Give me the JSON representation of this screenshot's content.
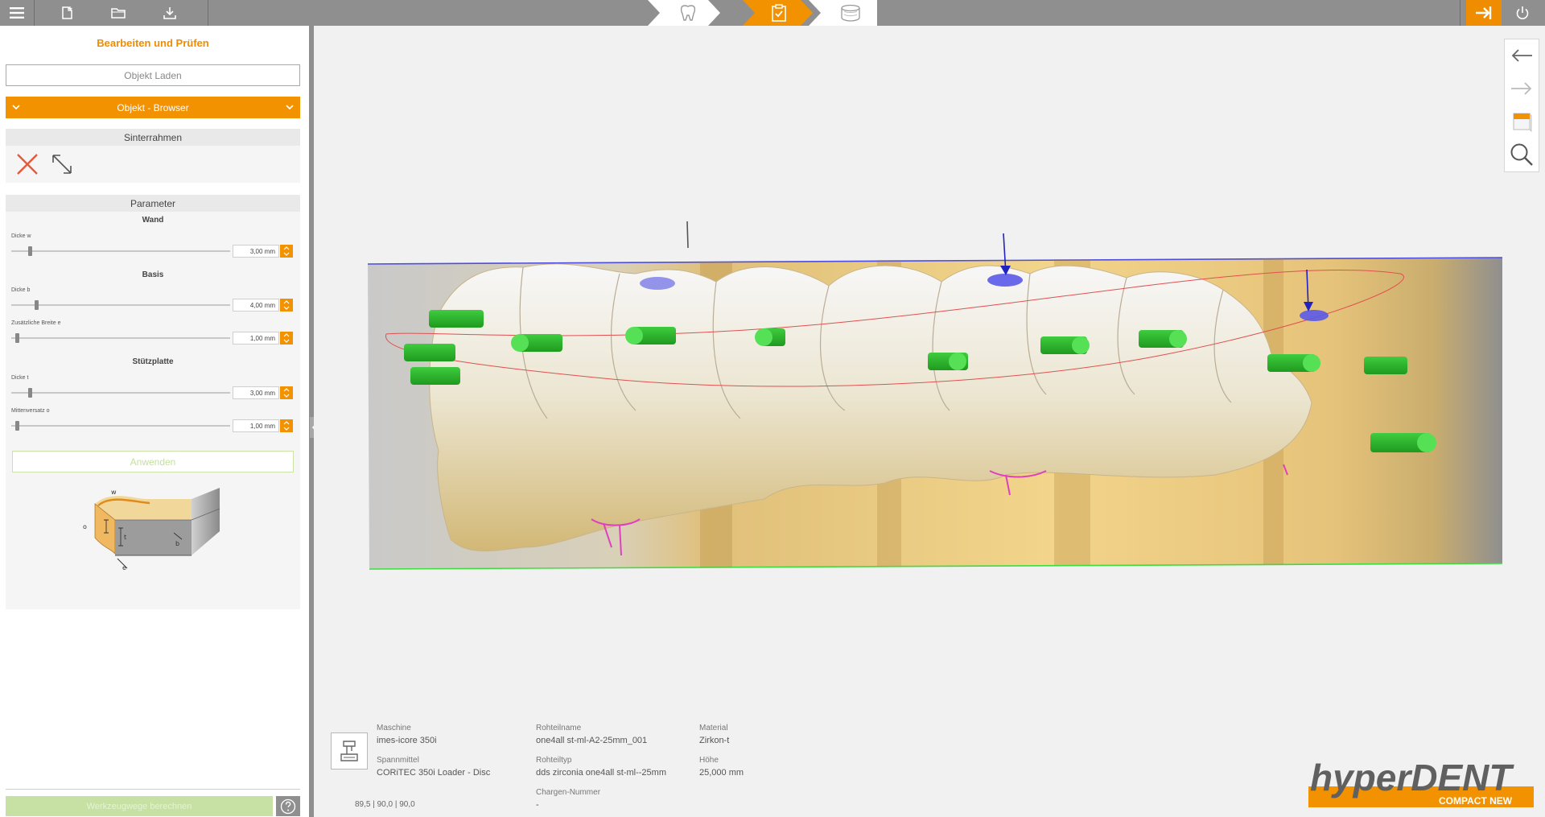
{
  "app": {
    "brand": "hyperDENT",
    "brand_sub": "COMPACT NEW",
    "accent": "#f39200"
  },
  "toolbar": {
    "icons": [
      "menu-icon",
      "new-file-icon",
      "open-folder-icon",
      "download-icon"
    ],
    "steps": [
      "tooth-step-icon",
      "checklist-step-icon",
      "blank-step-icon"
    ]
  },
  "panel": {
    "title": "Bearbeiten und Prüfen",
    "load_button": "Objekt Laden",
    "browser_label": "Objekt - Browser",
    "sinterrahmen": "Sinterrahmen",
    "parameter": "Parameter",
    "wand": {
      "title": "Wand",
      "dicke_label": "Dicke   w",
      "dicke_value": "3,00  mm",
      "dicke_slider": 0.08
    },
    "basis": {
      "title": "Basis",
      "dicke_label": "Dicke   b",
      "dicke_value": "4,00  mm",
      "dicke_slider": 0.11,
      "breite_label": "Zusätzliche Breite   e",
      "breite_value": "1,00  mm",
      "breite_slider": 0.02
    },
    "stuetzplatte": {
      "title": "Stützplatte",
      "dicke_label": "Dicke   t",
      "dicke_value": "3,00  mm",
      "dicke_slider": 0.08,
      "versatz_label": "Mittenversatz   o",
      "versatz_value": "1,00  mm",
      "versatz_slider": 0.02
    },
    "apply": "Anwenden",
    "diagram_letters": [
      "w",
      "o",
      "t",
      "b",
      "e"
    ],
    "compute": "Werkzeugwege berechnen"
  },
  "info": {
    "maschine_label": "Maschine",
    "maschine_value": "imes-icore 350i",
    "spann_label": "Spannmittel",
    "spann_value": "CORiTEC 350i Loader - Disc",
    "rohteil_label": "Rohteilname",
    "rohteil_value": "one4all st-ml-A2-25mm_001",
    "typ_label": "Rohteiltyp",
    "typ_value": "dds zirconia one4all st-ml--25mm",
    "charge_label": "Chargen-Nummer",
    "charge_value": "-",
    "material_label": "Material",
    "material_value": "Zirkon-t",
    "hoehe_label": "Höhe",
    "hoehe_value": "25,000 mm",
    "coords": "89,5  | 90,0 | 90,0"
  }
}
